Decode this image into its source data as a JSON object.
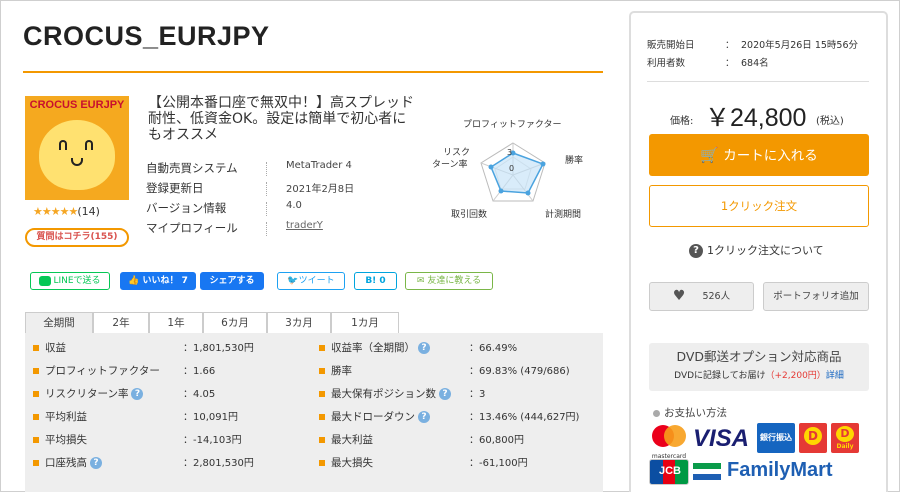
{
  "product": {
    "title": "CROCUS_EURJPY",
    "image_brand": "CROCUS EURJPY",
    "stars": "★★★★★",
    "review_count": "(14)",
    "question_button": "質問はコチラ(155)",
    "description": "【公開本番口座で無双中！】高スプレッド耐性、低資金OK。設定は簡単で初心者にもオススメ"
  },
  "info": [
    {
      "key": "自動売買システム",
      "value": "MetaTrader 4"
    },
    {
      "key": "登録更新日",
      "value": "2021年2月8日"
    },
    {
      "key": "バージョン情報",
      "value": "4.0"
    },
    {
      "key": "マイプロフィール",
      "value": "traderY"
    }
  ],
  "radar": {
    "labels": {
      "profit_factor": "プロフィットファクター",
      "win_rate": "勝率",
      "period": "計測期間",
      "trades": "取引回数",
      "risk_return": "リスク\nターン率"
    },
    "risk_return_line1": "リスク",
    "risk_return_line2": "ターン率",
    "scale_3": "3",
    "scale_0": "0"
  },
  "social": {
    "line": "LINEで送る",
    "fb_like": "いいね！ 7",
    "fb_share": "シェアする",
    "tweet": "ツイート",
    "hatena": "B! 0",
    "mail": "友達に教える"
  },
  "tabs": [
    "全期間",
    "2年",
    "1年",
    "6カ月",
    "3カ月",
    "1カ月"
  ],
  "stats_left": [
    {
      "key": "収益",
      "value": "：1,801,530円",
      "help": false
    },
    {
      "key": "プロフィットファクター",
      "value": "：1.66",
      "help": false
    },
    {
      "key": "リスクリターン率",
      "value": "：4.05",
      "help": true
    },
    {
      "key": "平均利益",
      "value": "：10,091円",
      "help": false
    },
    {
      "key": "平均損失",
      "value": "：-14,103円",
      "help": false
    },
    {
      "key": "口座残高",
      "value": "：2,801,530円",
      "help": true
    }
  ],
  "stats_right": [
    {
      "key": "収益率（全期間）",
      "value": "：66.49%",
      "help": true
    },
    {
      "key": "勝率",
      "value": "：69.83% (479/686)",
      "help": false
    },
    {
      "key": "最大保有ポジション数",
      "value": "：3",
      "help": true
    },
    {
      "key": "最大ドローダウン",
      "value": "：13.46% (444,627円)",
      "help": true
    },
    {
      "key": "最大利益",
      "value": "：60,800円",
      "help": false
    },
    {
      "key": "最大損失",
      "value": "：-61,100円",
      "help": false
    }
  ],
  "sidebar": {
    "release_label": "販売開始日",
    "release_value": "2020年5月26日 15時56分",
    "users_label": "利用者数",
    "users_value": "684名",
    "colon": "：",
    "price_label": "価格:",
    "price_value": "￥24,800",
    "price_tax": "(税込)",
    "cart_button": "カートに入れる",
    "oneclick_button": "1クリック注文",
    "about_oneclick": "1クリック注文について",
    "favorite_count": "526人",
    "portfolio_button": "ポートフォリオ追加",
    "dvd_title": "DVD郵送オプション対応商品",
    "dvd_sub_prefix": "DVDに記録してお届け",
    "dvd_sub_price": "（+2,200円）",
    "dvd_sub_link": "詳細",
    "payment_heading": "お支払い方法",
    "pay_mastercard": "mastercard",
    "pay_visa": "VISA",
    "pay_bank": "銀行振込",
    "pay_daily": "Daily",
    "pay_jcb": "JCB",
    "pay_familymart": "FamilyMart"
  },
  "colors": {
    "accent": "#f39800",
    "panel_bg": "#eeeeee",
    "facebook": "#1877f2",
    "line": "#06c755",
    "twitter": "#1da1f2"
  }
}
